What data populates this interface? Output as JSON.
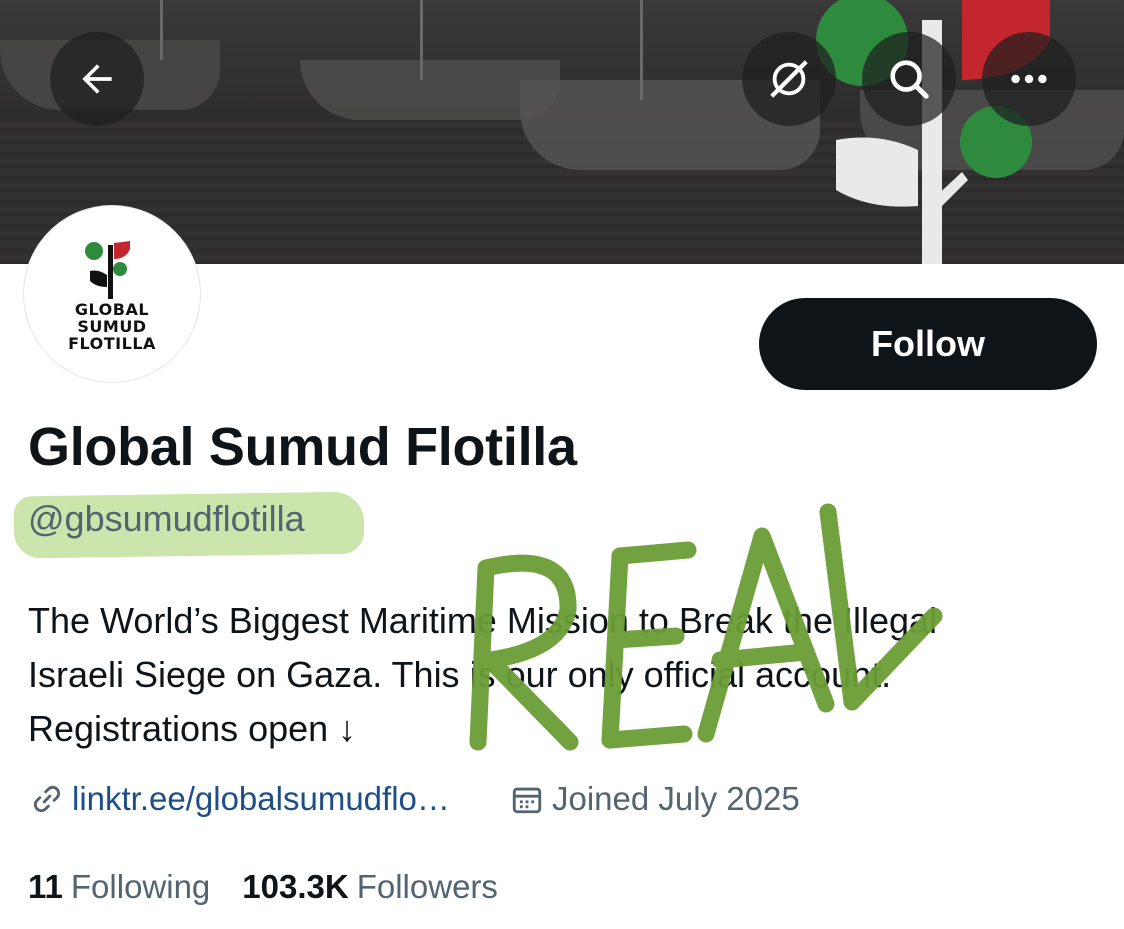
{
  "header": {
    "back_icon": "arrow-left-icon",
    "grok_icon": "grok-icon",
    "search_icon": "search-icon",
    "more_icon": "more-horizontal-icon"
  },
  "avatar": {
    "line1": "GLOBAL",
    "line2": "SUMUD",
    "line3": "FLOTILLA"
  },
  "profile": {
    "follow_label": "Follow",
    "display_name": "Global Sumud Flotilla",
    "handle": "@gbsumudflotilla",
    "bio_lines": [
      "The World’s Biggest Maritime Mission to Break the Illegal",
      "Israeli Siege on Gaza. This is our only official account.",
      "Registrations open ↓"
    ],
    "link": "linktr.ee/globalsumudflo…",
    "joined": "Joined July 2025",
    "following_count": "11",
    "following_label": "Following",
    "followers_count": "103.3K",
    "followers_label": "Followers"
  },
  "annotation": {
    "text": "REAL",
    "color": "#6a9e35",
    "highlight_color": "#b9dc92"
  },
  "colors": {
    "brand_green": "#2e8b3e",
    "brand_red": "#c4262e",
    "link_blue": "#1d4e89",
    "follow_bg": "#0f1419"
  }
}
